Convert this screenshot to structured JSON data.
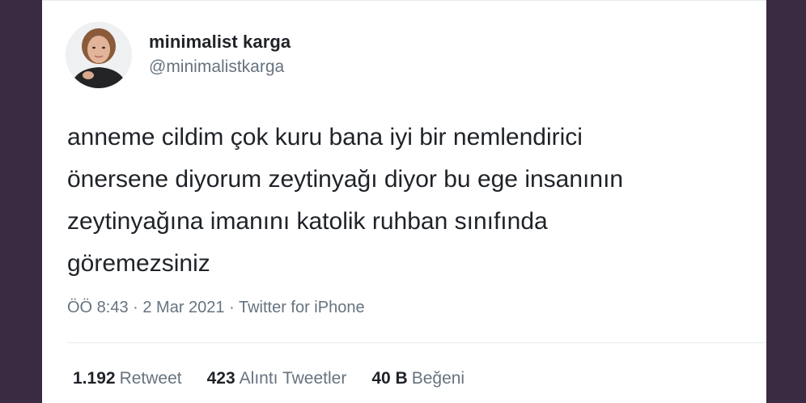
{
  "tweet": {
    "author": {
      "display_name": "minimalist karga",
      "handle": "@minimalistkarga"
    },
    "text": "anneme cildim çok kuru bana iyi bir nemlendirici\nönersene diyorum zeytinyağı diyor bu ege insanının\nzeytinyağına imanını katolik ruhban sınıfında\ngöremezsiniz",
    "meta": "ÖÖ 8:43 · 2 Mar 2021 · Twitter for iPhone",
    "stats": {
      "retweets": {
        "count": "1.192",
        "label": "Retweet"
      },
      "quotes": {
        "count": "423",
        "label": "Alıntı Tweetler"
      },
      "likes": {
        "count": "40 B",
        "label": "Beğeni"
      }
    }
  },
  "colors": {
    "background_frame": "#3a2a42",
    "card_background": "#ffffff",
    "text_primary": "#1f2328",
    "text_secondary": "#66737f",
    "divider": "#e6ecf0"
  }
}
